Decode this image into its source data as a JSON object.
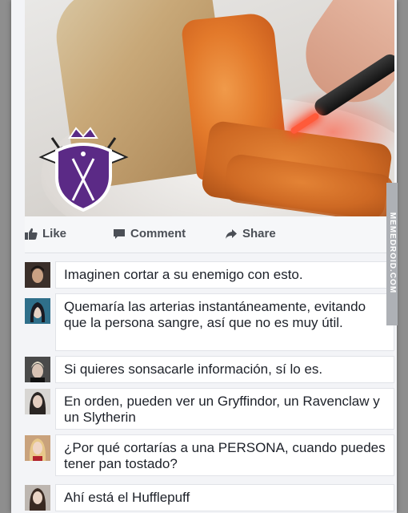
{
  "post": {
    "actions": {
      "like_label": "Like",
      "comment_label": "Comment",
      "share_label": "Share"
    }
  },
  "comments": [
    {
      "text": "Imaginen cortar a su enemigo con esto.",
      "avatar_icon": "avatar-man-dark-hair"
    },
    {
      "text": "Quemaría las arterias instantáneamente, evitando que la persona sangre, así que no es muy útil.",
      "avatar_icon": "avatar-woman-dark-hair-blue"
    },
    {
      "text": "Si quieres sonsacarle información, sí lo es.",
      "avatar_icon": "avatar-man-blond"
    },
    {
      "text": "En orden, pueden ver un Gryffindor, un Ravenclaw y un Slytherin",
      "avatar_icon": "avatar-woman-long-hair"
    },
    {
      "text": "¿Por qué cortarías a una PERSONA, cuando puedes tener pan tostado?",
      "avatar_icon": "avatar-woman-blonde"
    },
    {
      "text": "Ahí está el Hufflepuff",
      "avatar_icon": "avatar-woman-dark-hair"
    }
  ],
  "side_watermark": "MEMEDROID.COM",
  "colors": {
    "action_text": "#4b4f56",
    "frame_bg": "#f3f4f7",
    "bubble_bg": "#ffffff",
    "logo_purple": "#5b2a86"
  }
}
